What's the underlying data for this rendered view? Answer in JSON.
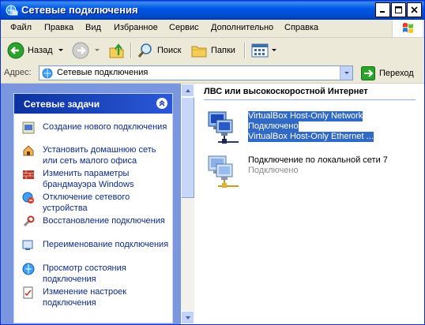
{
  "window": {
    "title": "Сетевые подключения"
  },
  "menu": {
    "items": [
      "Файл",
      "Правка",
      "Вид",
      "Избранное",
      "Сервис",
      "Дополнительно",
      "Справка"
    ]
  },
  "toolbar": {
    "back": "Назад",
    "search": "Поиск",
    "folders": "Папки"
  },
  "address": {
    "label": "Адрес:",
    "value": "Сетевые подключения",
    "go": "Переход"
  },
  "tasks": {
    "title": "Сетевые задачи",
    "items": [
      {
        "label": "Создание нового подключения",
        "icon": "new-connection-icon"
      },
      {
        "label": "Установить домашнюю сеть или сеть малого офиса",
        "icon": "home-network-icon"
      },
      {
        "label": "Изменить параметры брандмауэра Windows",
        "icon": "firewall-icon"
      },
      {
        "label": "Отключение сетевого устройства",
        "icon": "disable-device-icon"
      },
      {
        "label": "Восстановление подключения",
        "icon": "repair-icon"
      },
      {
        "label": "Переименование подключения",
        "icon": "rename-icon"
      },
      {
        "label": "Просмотр состояния подключения",
        "icon": "status-icon"
      },
      {
        "label": "Изменение настроек подключения",
        "icon": "settings-icon"
      }
    ]
  },
  "group": {
    "title": "ЛВС или высокоскоростной Интернет"
  },
  "connections": [
    {
      "name": "VirtualBox Host-Only Network",
      "status": "Подключено",
      "device": "VirtualBox Host-Only Ethernet ...",
      "selected": true
    },
    {
      "name": "Подключение по локальной сети 7",
      "status": "Подключено",
      "selected": false
    }
  ],
  "colors": {
    "title_bar": "#0058e6",
    "task_header": "#0c32a0",
    "left_pane": "#7a96df",
    "selection": "#316ac5"
  }
}
